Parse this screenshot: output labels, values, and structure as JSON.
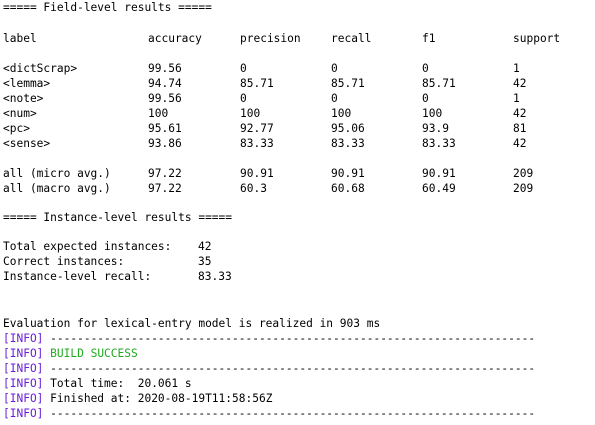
{
  "field_header": "===== Field-level results =====",
  "columns": [
    "label",
    "accuracy",
    "precision",
    "recall",
    "f1",
    "support"
  ],
  "rows": [
    [
      "<dictScrap>",
      "99.56",
      "0",
      "0",
      "0",
      "1"
    ],
    [
      "<lemma>",
      "94.74",
      "85.71",
      "85.71",
      "85.71",
      "42"
    ],
    [
      "<note>",
      "99.56",
      "0",
      "0",
      "0",
      "1"
    ],
    [
      "<num>",
      "100",
      "100",
      "100",
      "100",
      "42"
    ],
    [
      "<pc>",
      "95.61",
      "92.77",
      "95.06",
      "93.9",
      "81"
    ],
    [
      "<sense>",
      "93.86",
      "83.33",
      "83.33",
      "83.33",
      "42"
    ]
  ],
  "averages": [
    [
      "all (micro avg.)",
      "97.22",
      "90.91",
      "90.91",
      "90.91",
      "209"
    ],
    [
      "all (macro avg.)",
      "97.22",
      "60.3",
      "60.68",
      "60.49",
      "209"
    ]
  ],
  "instance_header": "===== Instance-level results =====",
  "instance_stats": [
    {
      "label": "Total expected instances:",
      "value": "42"
    },
    {
      "label": "Correct instances:",
      "value": "35"
    },
    {
      "label": "Instance-level recall:",
      "value": "83.33"
    }
  ],
  "evaluation_text": "Evaluation for lexical-entry model is realized in 903 ms",
  "maven": {
    "tag": "[INFO]",
    "separator": " ------------------------------------------------------------------------",
    "build_status": "BUILD SUCCESS",
    "total_time": " Total time:  20.061 s",
    "finished_at": " Finished at: 2020-08-19T11:58:56Z"
  },
  "colors": {
    "background": "#ffffff",
    "text": "#000000",
    "info_tag": "#6a1ed8",
    "success": "#1faa1f"
  }
}
